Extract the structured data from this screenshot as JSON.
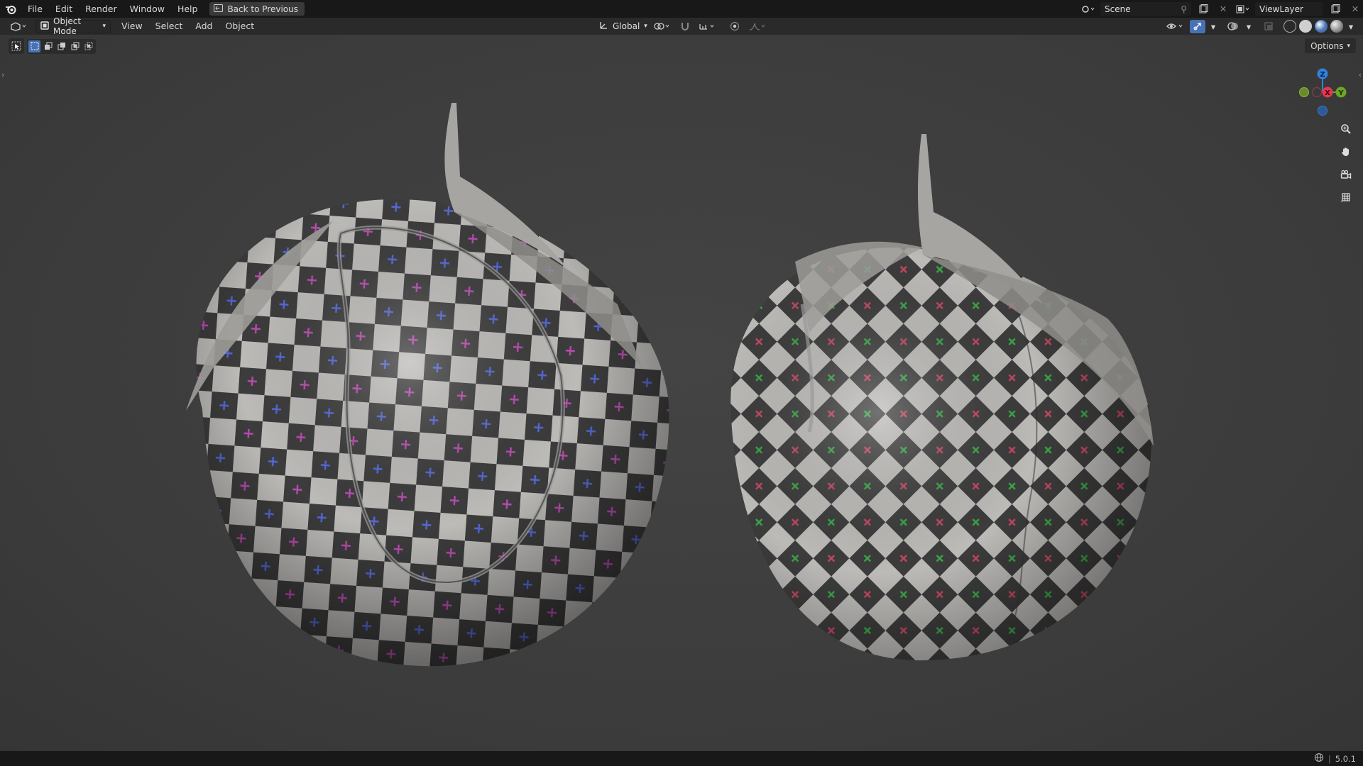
{
  "topbar": {
    "menus": [
      "File",
      "Edit",
      "Render",
      "Window",
      "Help"
    ],
    "back_label": "Back to Previous",
    "scene": "Scene",
    "view_layer": "ViewLayer"
  },
  "viewport_header": {
    "mode": "Object Mode",
    "menus": [
      "View",
      "Select",
      "Add",
      "Object"
    ],
    "orientation": "Global"
  },
  "viewport": {
    "options_label": "Options",
    "gizmo": {
      "z": "Z",
      "x": "X",
      "y": "Y"
    }
  },
  "statusbar": {
    "version": "5.0.1"
  },
  "colors": {
    "accent": "#4772b3",
    "x_axis": "#e8364f",
    "y_axis": "#6ba624",
    "z_axis": "#2f83e0"
  },
  "icons": {
    "logo": "blender-logo-icon",
    "back": "back-icon",
    "editor_type": "3d-viewport-icon",
    "select_box": "select-box-icon",
    "zoom": "zoom-icon",
    "pan": "hand-icon",
    "camera": "camera-icon",
    "grid": "grid-icon"
  }
}
